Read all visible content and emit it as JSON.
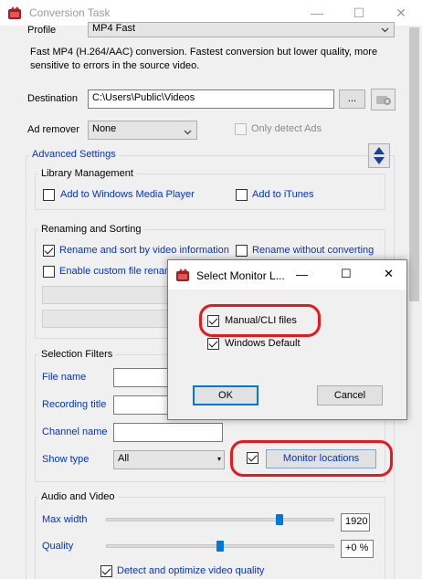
{
  "window": {
    "title": "Conversion Task",
    "minimize": "—",
    "maximize": "☐",
    "close": "✕"
  },
  "profile": {
    "label": "Profile",
    "value": "MP4 Fast"
  },
  "description": "Fast MP4 (H.264/AAC) conversion.  Fastest conversion but lower quality, more sensitive to errors in the source video.",
  "destination": {
    "label": "Destination",
    "value": "C:\\Users\\Public\\Videos",
    "browse_label": "..."
  },
  "ad_remover": {
    "label": "Ad remover",
    "value": "None",
    "only_detect_label": "Only detect Ads"
  },
  "advanced": {
    "label": "Advanced Settings"
  },
  "library": {
    "title": "Library Management",
    "wmp_label": "Add to Windows Media Player",
    "itunes_label": "Add to iTunes"
  },
  "renaming": {
    "title": "Renaming and Sorting",
    "rename_sort_label": "Rename and sort by video information",
    "rename_without_label": "Rename without converting",
    "custom_label": "Enable custom file renam"
  },
  "filters": {
    "title": "Selection Filters",
    "file_name_label": "File name",
    "recording_title_label": "Recording title",
    "channel_name_label": "Channel name",
    "show_type_label": "Show type",
    "show_type_value": "All",
    "monitor_locations_label": "Monitor locations"
  },
  "audio_video": {
    "title": "Audio and Video",
    "max_width_label": "Max width",
    "max_width_value": "1920",
    "max_width_level": 0.76,
    "quality_label": "Quality",
    "quality_value": "+0 %",
    "quality_level": 0.5,
    "detect_label": "Detect and optimize video quality"
  },
  "dialog": {
    "title": "Select Monitor L...",
    "minimize": "—",
    "maximize": "☐",
    "close": "✕",
    "manual_cli_label": "Manual/CLI files",
    "windows_default_label": "Windows Default",
    "ok_label": "OK",
    "cancel_label": "Cancel"
  },
  "colors": {
    "accent": "#0078d7",
    "link_text": "#0033cc",
    "highlight": "#e8181d"
  }
}
